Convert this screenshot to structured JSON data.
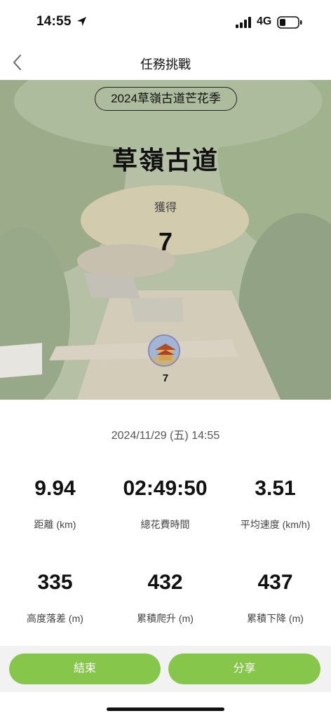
{
  "status_bar": {
    "time": "14:55",
    "network": "4G"
  },
  "nav": {
    "title": "任務挑戰"
  },
  "hero": {
    "event_name": "2024草嶺古道芒花季",
    "route_name": "草嶺古道",
    "earned_label": "獲得",
    "earned_value": "7",
    "badge_count": "7"
  },
  "date": "2024/11/29 (五) 14:55",
  "stats": [
    {
      "value": "9.94",
      "label": "距離 (km)"
    },
    {
      "value": "02:49:50",
      "label": "總花費時間"
    },
    {
      "value": "3.51",
      "label": "平均速度 (km/h)"
    },
    {
      "value": "335",
      "label": "高度落差 (m)"
    },
    {
      "value": "432",
      "label": "累積爬升 (m)"
    },
    {
      "value": "437",
      "label": "累積下降 (m)"
    }
  ],
  "buttons": {
    "end": "結束",
    "share": "分享"
  },
  "colors": {
    "accent": "#86c64a"
  }
}
